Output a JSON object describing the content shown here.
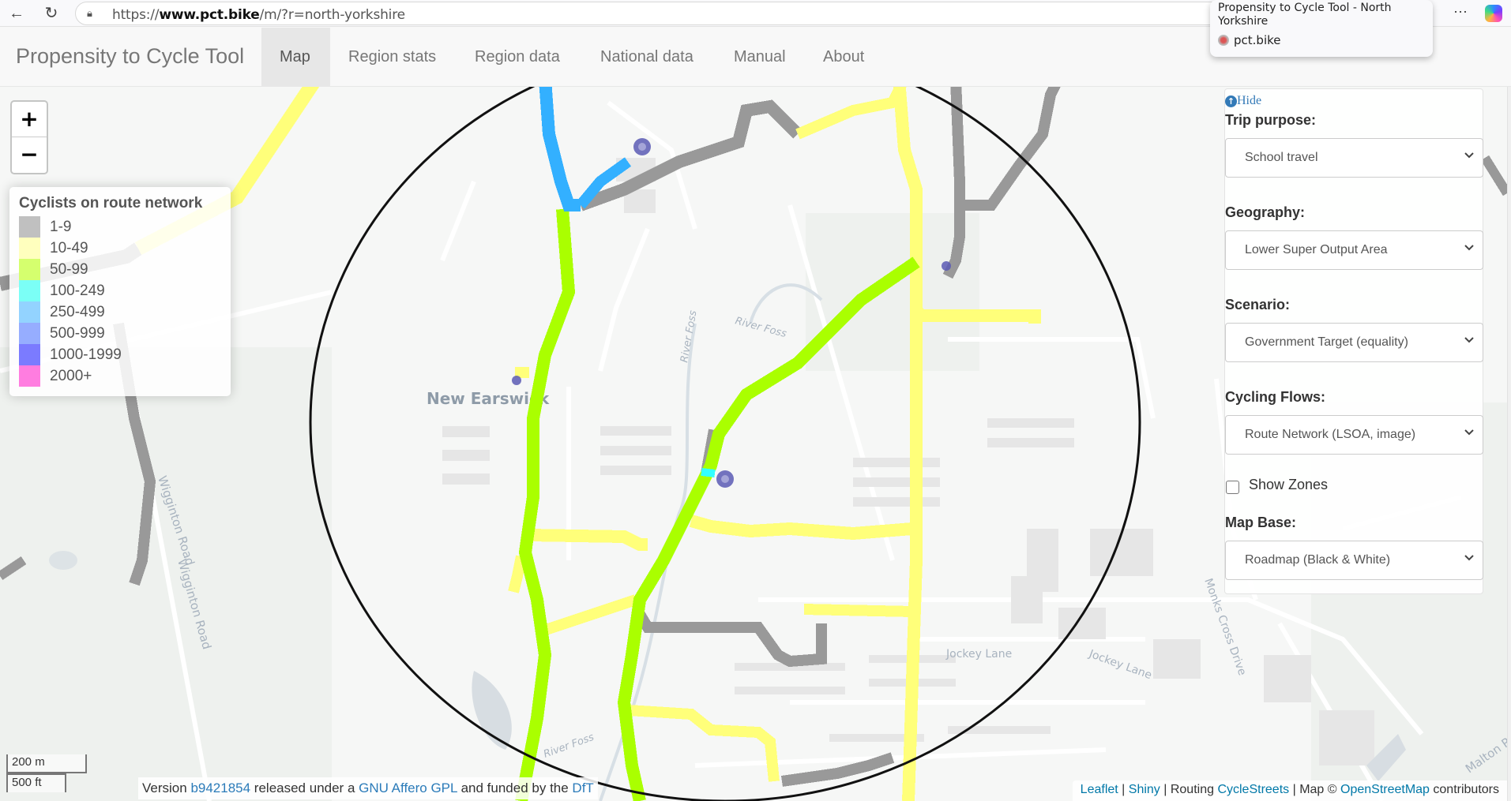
{
  "browser": {
    "url_prefix": "https://",
    "url_host": "www.pct.bike",
    "url_path": "/m/?r=north-yorkshire",
    "back_icon": "arrow-left-icon",
    "reload_icon": "reload-icon",
    "more_label": "···"
  },
  "tooltip": {
    "title": "Propensity to Cycle Tool - North Yorkshire",
    "site": "pct.bike"
  },
  "navbar": {
    "brand": "Propensity to Cycle Tool",
    "tabs": [
      {
        "label": "Map",
        "active": true
      },
      {
        "label": "Region stats",
        "active": false
      },
      {
        "label": "Region data",
        "active": false
      },
      {
        "label": "National data",
        "active": false
      },
      {
        "label": "Manual",
        "active": false
      },
      {
        "label": "About",
        "active": false
      }
    ]
  },
  "map": {
    "zoom_in": "+",
    "zoom_out": "−",
    "place_labels": [
      "New Earswick",
      "River Foss",
      "River Foss",
      "Wigginton Road",
      "Wigginton Road",
      "Jockey Lane",
      "Jockey Lane",
      "Monks Cross Drive",
      "River Foss",
      "Malton Road"
    ],
    "scale": {
      "metric": "200 m",
      "imperial": "500 ft"
    }
  },
  "legend": {
    "title": "Cyclists on route network",
    "items": [
      {
        "label": "1-9",
        "color": "#c0c0c0"
      },
      {
        "label": "10-49",
        "color": "#ffffbe"
      },
      {
        "label": "50-99",
        "color": "#d5ff6e"
      },
      {
        "label": "100-249",
        "color": "#7bfff6"
      },
      {
        "label": "250-499",
        "color": "#93d3ff"
      },
      {
        "label": "500-999",
        "color": "#96adff"
      },
      {
        "label": "1000-1999",
        "color": "#7b7bff"
      },
      {
        "label": "2000+",
        "color": "#ff7de0"
      }
    ]
  },
  "route_colors": {
    "gray": "#999999",
    "yellow": "#ffff7a",
    "green": "#aaff00",
    "cyan": "#33ffff",
    "blue": "#33b0ff",
    "marker": "#5a5ab4"
  },
  "panel": {
    "hide_label": "Hide",
    "fields": [
      {
        "label": "Trip purpose:",
        "value": "School travel"
      },
      {
        "label": "Geography:",
        "value": "Lower Super Output Area"
      },
      {
        "label": "Scenario:",
        "value": "Government Target (equality)"
      },
      {
        "label": "Cycling Flows:",
        "value": "Route Network (LSOA, image)"
      }
    ],
    "show_zones": {
      "label": "Show Zones",
      "checked": false
    },
    "map_base": {
      "label": "Map Base:",
      "value": "Roadmap (Black & White)"
    }
  },
  "footer": {
    "version_prefix": "Version ",
    "version": "b9421854",
    "released_text": " released under a ",
    "license": "GNU Affero GPL",
    "funded_text": " and funded by the ",
    "funder": "DfT",
    "attribution": {
      "leaflet": "Leaflet",
      "sep1": " | ",
      "shiny": "Shiny",
      "routing_text": " | Routing ",
      "cyclestreets": "CycleStreets",
      "map_text": " | Map © ",
      "osm": "OpenStreetMap",
      "contrib_text": " contributors"
    }
  }
}
